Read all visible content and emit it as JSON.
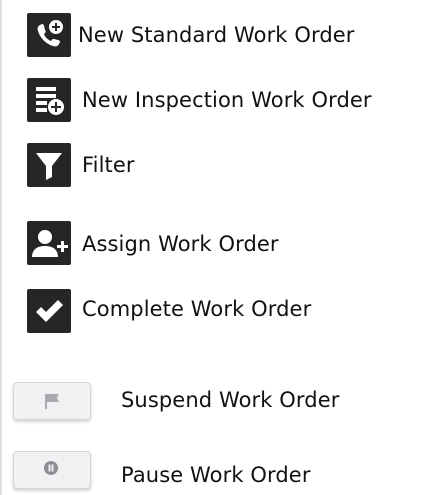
{
  "actions": [
    {
      "label": "New Standard Work Order",
      "icon": "phone-add-icon"
    },
    {
      "label": "New Inspection Work Order",
      "icon": "list-add-icon"
    },
    {
      "label": "Filter",
      "icon": "filter-icon"
    },
    {
      "label": "Assign Work Order",
      "icon": "user-add-icon"
    },
    {
      "label": "Complete Work Order",
      "icon": "checkmark-icon"
    },
    {
      "label": "Suspend Work Order",
      "icon": "flag-icon"
    },
    {
      "label": "Pause Work Order",
      "icon": "pause-icon"
    }
  ],
  "colors": {
    "icon_dark_bg": "#262626",
    "icon_light_bg": "#f1f1f3",
    "icon_light_glyph": "#a9a9ae",
    "text": "#111111"
  }
}
